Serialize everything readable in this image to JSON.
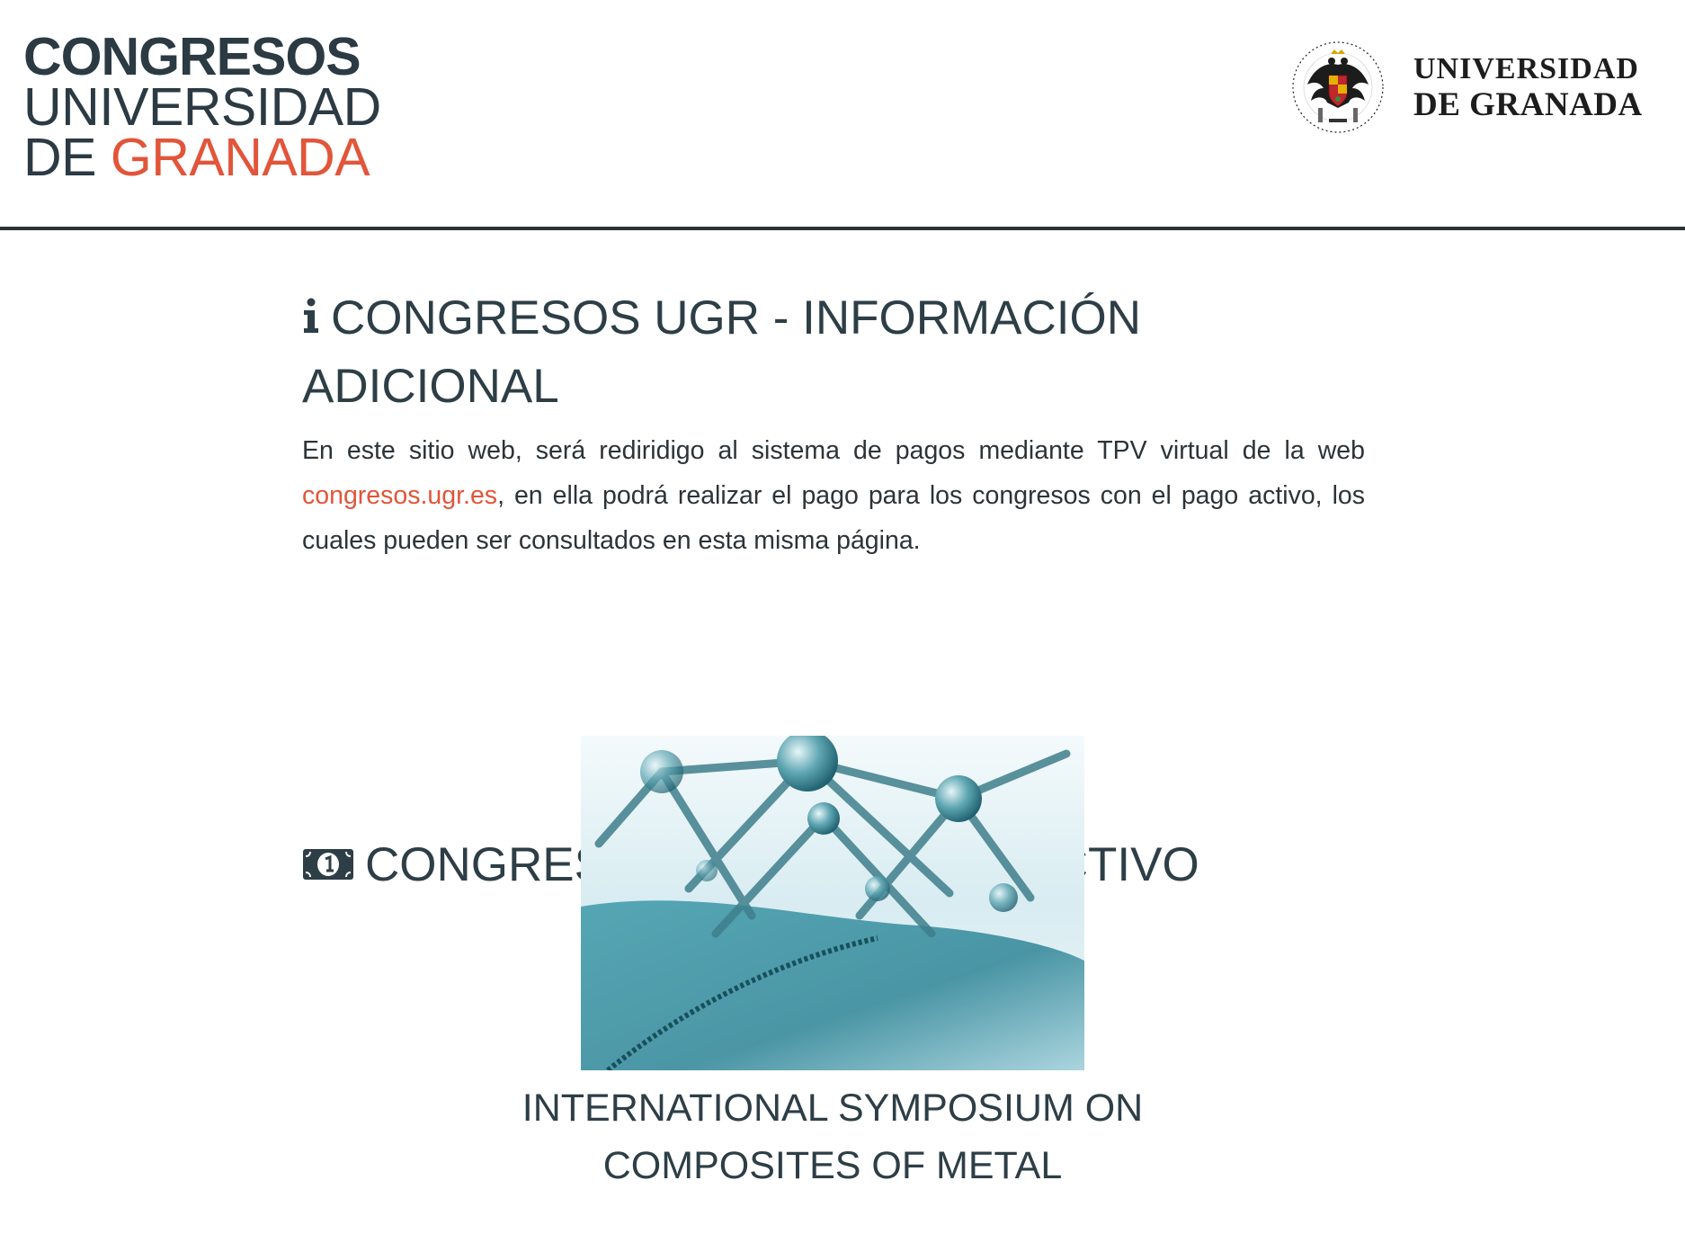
{
  "header": {
    "brand": {
      "line1": "CONGRESOS",
      "line2": "UNIVERSIDAD",
      "line3_prefix": "DE ",
      "line3_accent": "GRANADA"
    },
    "university": {
      "line1": "UNIVERSIDAD",
      "line2": "DE GRANADA",
      "seal_icon": "university-seal-icon"
    }
  },
  "info_section": {
    "icon": "info-icon",
    "title": "CONGRESOS UGR - INFORMACIÓN ADICIONAL",
    "text_before_link": "En este sitio web, será rediridigo al sistema de pagos mediante TPV virtual de la web ",
    "link_text": "congresos.ugr.es",
    "text_after_link": ", en ella podrá realizar el pago para los congresos con el pago activo, los cuales pueden ser consultados en esta misma página."
  },
  "payment_section": {
    "icon": "money-bill-icon",
    "title": "CONGRESOS CON EL PAGO ACTIVO"
  },
  "congresses": [
    {
      "name": "INTERNATIONAL SYMPOSIUM ON COMPOSITES OF METAL",
      "image_icon": "molecular-structure-image"
    }
  ],
  "colors": {
    "text": "#2d3e46",
    "accent": "#e2553a",
    "header_border": "#2d3238"
  }
}
